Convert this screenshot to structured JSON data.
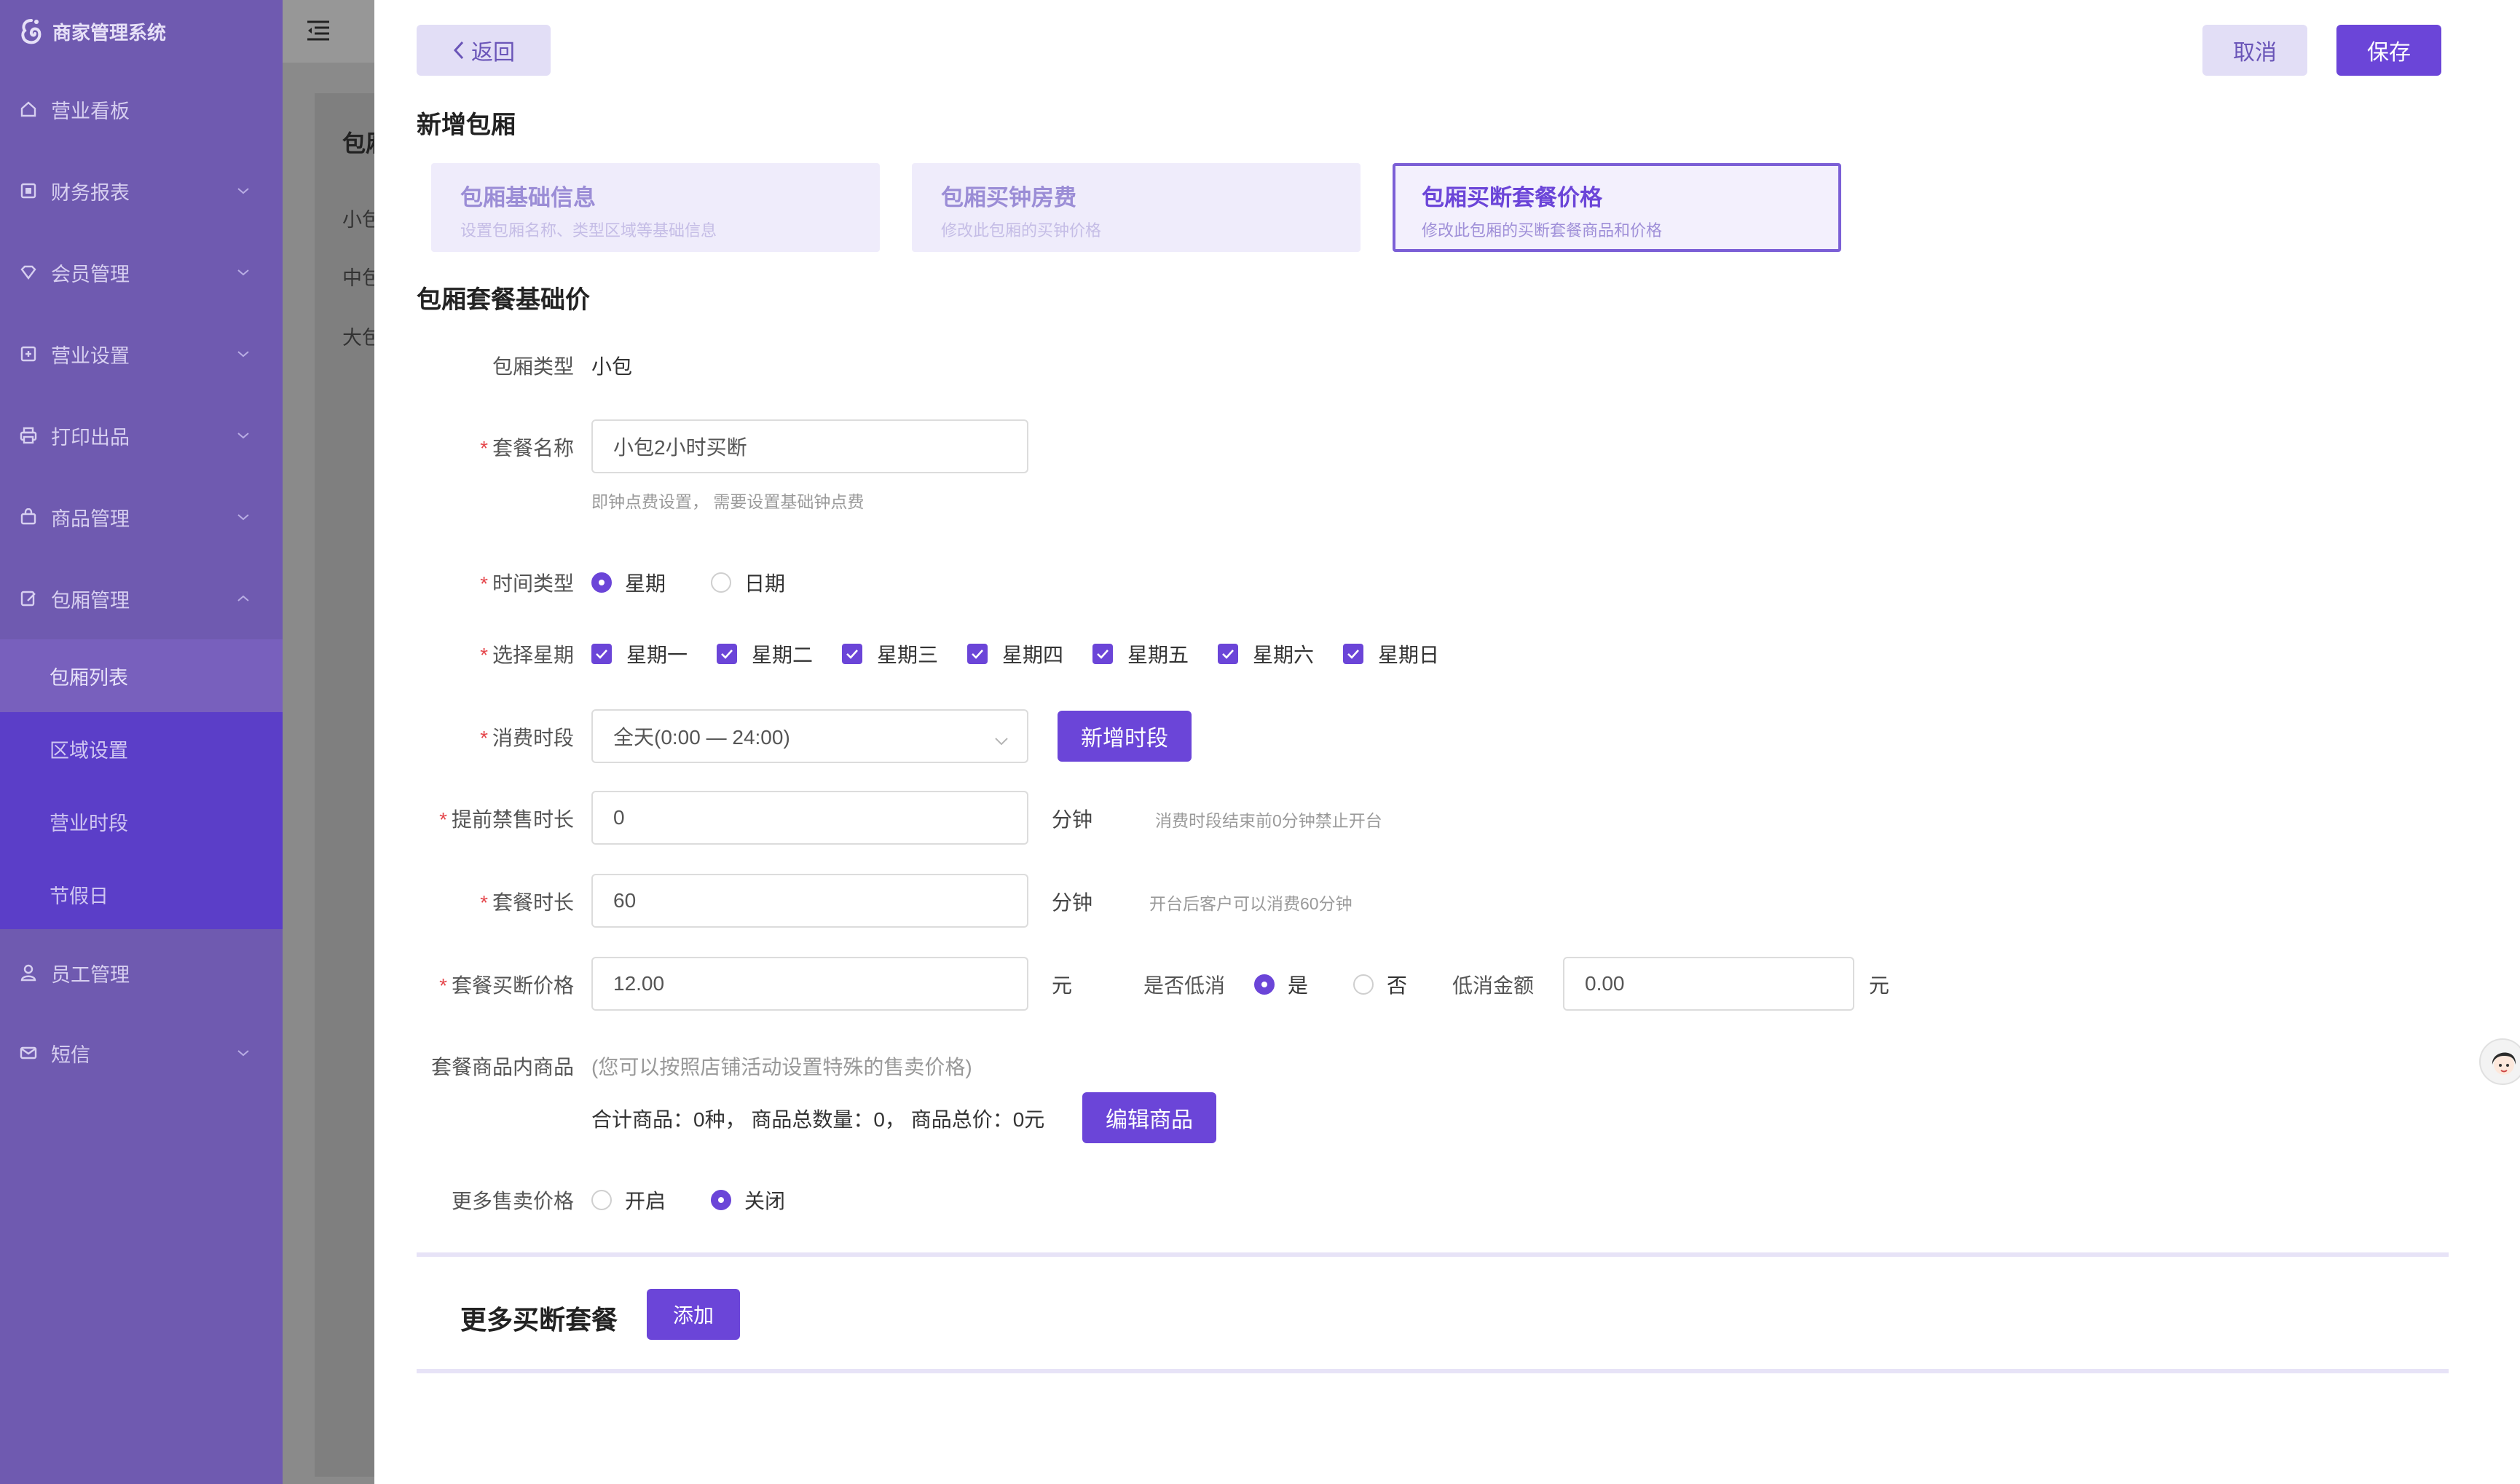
{
  "app": {
    "title": "商家管理系统"
  },
  "sidebar": {
    "items": [
      {
        "label": "营业看板",
        "icon": "home-icon"
      },
      {
        "label": "财务报表",
        "icon": "report-icon"
      },
      {
        "label": "会员管理",
        "icon": "member-icon"
      },
      {
        "label": "营业设置",
        "icon": "settings-icon"
      },
      {
        "label": "打印出品",
        "icon": "printer-icon"
      },
      {
        "label": "商品管理",
        "icon": "bag-icon"
      },
      {
        "label": "包厢管理",
        "icon": "edit-icon"
      },
      {
        "label": "员工管理",
        "icon": "user-icon"
      },
      {
        "label": "短信",
        "icon": "mail-icon"
      }
    ],
    "submenu": [
      "包厢列表",
      "区域设置",
      "营业时段",
      "节假日"
    ]
  },
  "background": {
    "heading": "包厢",
    "rows": [
      "小包",
      "中包",
      "大包"
    ]
  },
  "drawer": {
    "back_label": "返回",
    "cancel_label": "取消",
    "save_label": "保存",
    "title": "新增包厢",
    "steps": [
      {
        "title": "包厢基础信息",
        "desc": "设置包厢名称、类型区域等基础信息"
      },
      {
        "title": "包厢买钟房费",
        "desc": "修改此包厢的买钟价格"
      },
      {
        "title": "包厢买断套餐价格",
        "desc": "修改此包厢的买断套餐商品和价格"
      }
    ],
    "section_title": "包厢套餐基础价"
  },
  "form": {
    "room_type": {
      "label": "包厢类型",
      "value": "小包"
    },
    "package_name": {
      "label": "套餐名称",
      "value": "小包2小时买断",
      "hint": "即钟点费设置， 需要设置基础钟点费"
    },
    "time_type": {
      "label": "时间类型",
      "options": [
        "星期",
        "日期"
      ],
      "selected": "星期"
    },
    "weekdays": {
      "label": "选择星期",
      "options": [
        "星期一",
        "星期二",
        "星期三",
        "星期四",
        "星期五",
        "星期六",
        "星期日"
      ]
    },
    "period": {
      "label": "消费时段",
      "value": "全天(0:00 — 24:00)",
      "add_label": "新增时段"
    },
    "advance_stop": {
      "label": "提前禁售时长",
      "value": "0",
      "unit": "分钟",
      "hint": "消费时段结束前0分钟禁止开台"
    },
    "duration": {
      "label": "套餐时长",
      "value": "60",
      "unit": "分钟",
      "hint": "开台后客户可以消费60分钟"
    },
    "price": {
      "label": "套餐买断价格",
      "value": "12.00",
      "unit": "元"
    },
    "min_spend": {
      "label": "是否低消",
      "options": [
        "是",
        "否"
      ],
      "selected": "是",
      "amount_label": "低消金额",
      "amount_value": "0.00",
      "unit": "元"
    },
    "goods": {
      "label": "套餐商品内商品",
      "note": "(您可以按照店铺活动设置特殊的售卖价格)",
      "summary": "合计商品：0种， 商品总数量：0， 商品总价：0元",
      "edit_label": "编辑商品"
    },
    "more_prices": {
      "label": "更多售卖价格",
      "options": [
        "开启",
        "关闭"
      ],
      "selected": "关闭"
    }
  },
  "more_packages": {
    "title": "更多买断套餐",
    "add_label": "添加"
  },
  "colors": {
    "primary": "#6b45d8",
    "sidebar": "#6f5ab0",
    "submenu": "#5b3ec8"
  }
}
